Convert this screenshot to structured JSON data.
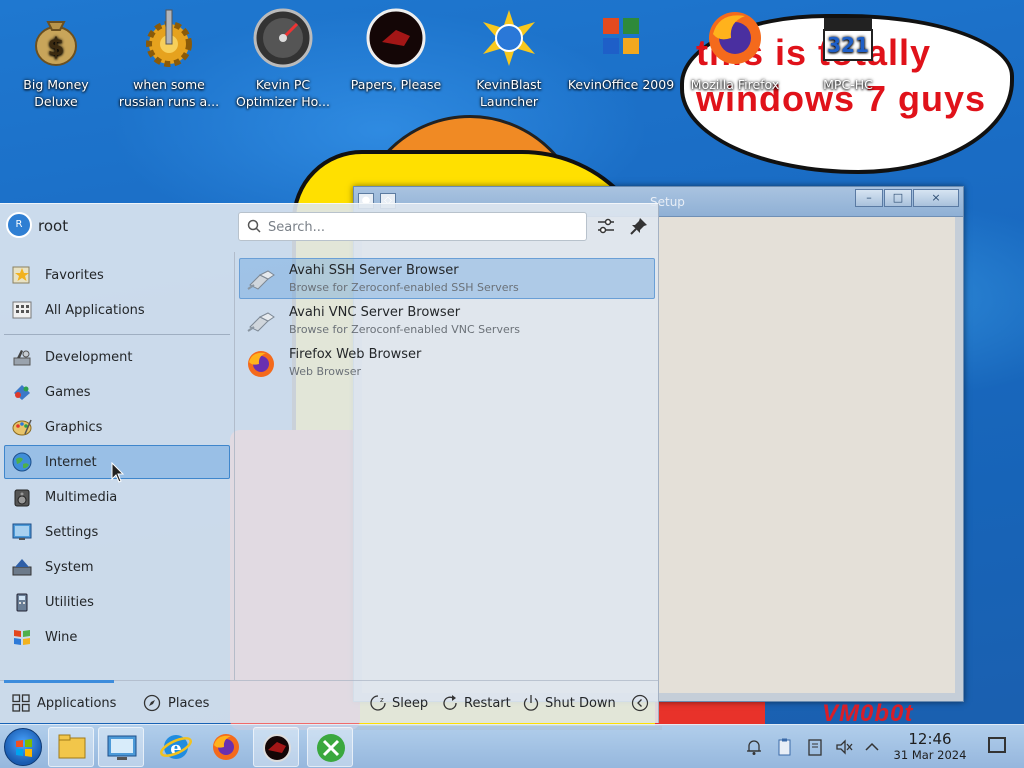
{
  "desktop": {
    "icons": [
      {
        "label": "Big Money Deluxe",
        "icon": "money-bag-icon"
      },
      {
        "label": "when some russian runs a...",
        "icon": "gear-icon"
      },
      {
        "label": "Kevin PC Optimizer Ho...",
        "icon": "gauge-icon"
      },
      {
        "label": "Papers, Please",
        "icon": "papers-please-icon"
      },
      {
        "label": "KevinBlast Launcher",
        "icon": "burst-globe-icon"
      },
      {
        "label": "KevinOffice 2009",
        "icon": "office-icon"
      },
      {
        "label": "Mozilla Firefox",
        "icon": "firefox-icon"
      },
      {
        "label": "MPC-HC",
        "icon": "mpc-hc-icon"
      }
    ],
    "bubble_line1": "this is totally",
    "bubble_line2": "windows 7 guys",
    "watermark": "VM0b0t"
  },
  "background_window": {
    "title": "Setup",
    "buttons": [
      "–",
      "□",
      "×"
    ]
  },
  "launcher": {
    "user": "root",
    "avatar_initial": "R",
    "search_placeholder": "Search...",
    "categories": [
      {
        "label": "Favorites",
        "icon": "star-icon"
      },
      {
        "label": "All Applications",
        "icon": "grid-icon"
      },
      {
        "label": "Development",
        "icon": "development-icon"
      },
      {
        "label": "Games",
        "icon": "games-icon"
      },
      {
        "label": "Graphics",
        "icon": "graphics-icon"
      },
      {
        "label": "Internet",
        "icon": "globe-icon",
        "active": true
      },
      {
        "label": "Multimedia",
        "icon": "multimedia-icon"
      },
      {
        "label": "Settings",
        "icon": "settings-icon"
      },
      {
        "label": "System",
        "icon": "system-icon"
      },
      {
        "label": "Utilities",
        "icon": "utilities-icon"
      },
      {
        "label": "Wine",
        "icon": "wine-icon"
      }
    ],
    "apps": [
      {
        "name": "Avahi SSH Server Browser",
        "desc": "Browse for Zeroconf-enabled SSH Servers",
        "icon": "network-icon",
        "active": true
      },
      {
        "name": "Avahi VNC Server Browser",
        "desc": "Browse for Zeroconf-enabled VNC Servers",
        "icon": "network-icon"
      },
      {
        "name": "Firefox Web Browser",
        "desc": "Web Browser",
        "icon": "firefox-icon"
      }
    ],
    "footer": {
      "tabs": [
        "Applications",
        "Places"
      ],
      "power": [
        "Sleep",
        "Restart",
        "Shut Down"
      ]
    }
  },
  "taskbar": {
    "time": "12:46",
    "date": "31 Mar 2024",
    "pinned": [
      "file-manager-icon",
      "system-settings-icon",
      "internet-explorer-icon",
      "firefox-icon",
      "papers-please-icon",
      "tools-icon"
    ]
  },
  "colors": {
    "accent": "#3d8cdc",
    "bubble_text": "#e0121a",
    "desktop_bg": "#1a6cc4"
  }
}
